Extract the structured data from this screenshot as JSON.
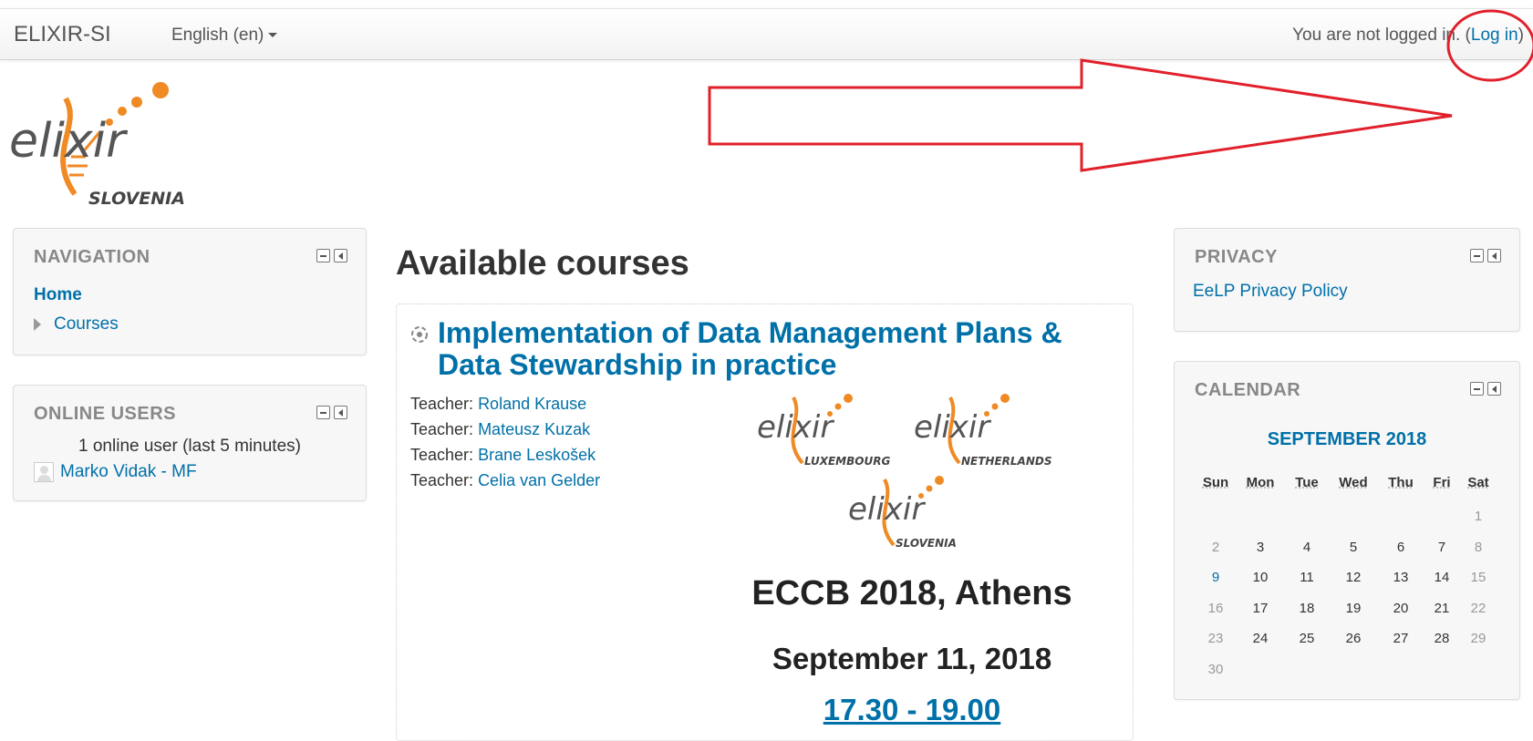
{
  "navbar": {
    "brand": "ELIXIR-SI",
    "language": "English (en)",
    "login_prefix": "You are not logged in.",
    "login_link": "Log in"
  },
  "logo": {
    "text": "elixir",
    "sub": "SLOVENIA"
  },
  "navigation": {
    "title": "NAVIGATION",
    "home": "Home",
    "courses": "Courses"
  },
  "online_users": {
    "title": "ONLINE USERS",
    "count": "1 online user (last 5 minutes)",
    "users": [
      "Marko Vidak - MF"
    ]
  },
  "main": {
    "heading": "Available courses",
    "course": {
      "title": "Implementation of Data Management Plans & Data Stewardship in practice",
      "teacher_label": "Teacher:",
      "teachers": [
        "Roland Krause",
        "Mateusz Kuzak",
        "Brane Leskošek",
        "Celia van Gelder"
      ],
      "logos": [
        {
          "text": "elixir",
          "sub": "LUXEMBOURG"
        },
        {
          "text": "elixir",
          "sub": "NETHERLANDS"
        },
        {
          "text": "elixir",
          "sub": "SLOVENIA"
        }
      ],
      "event": "ECCB 2018, Athens",
      "date": "September 11, 2018",
      "time": "17.30 - 19.00"
    }
  },
  "privacy": {
    "title": "PRIVACY",
    "link": "EeLP Privacy Policy"
  },
  "calendar": {
    "title": "CALENDAR",
    "month": "SEPTEMBER 2018",
    "days": [
      "Sun",
      "Mon",
      "Tue",
      "Wed",
      "Thu",
      "Fri",
      "Sat"
    ],
    "weeks": [
      [
        "",
        "",
        "",
        "",
        "",
        "",
        "1"
      ],
      [
        "2",
        "3",
        "4",
        "5",
        "6",
        "7",
        "8"
      ],
      [
        "9",
        "10",
        "11",
        "12",
        "13",
        "14",
        "15"
      ],
      [
        "16",
        "17",
        "18",
        "19",
        "20",
        "21",
        "22"
      ],
      [
        "23",
        "24",
        "25",
        "26",
        "27",
        "28",
        "29"
      ],
      [
        "30",
        "",
        "",
        "",
        "",
        "",
        ""
      ]
    ],
    "today": "9"
  },
  "colors": {
    "link": "#0070a8",
    "annotation": "#e0202a",
    "logo_orange": "#f08a24",
    "logo_gray": "#555555"
  },
  "icons": {
    "lang_caret": "chevron-down-icon",
    "minimize": "minimize-icon",
    "dock": "dock-icon",
    "expand": "triangle-right-icon",
    "course": "course-icon",
    "avatar": "user-avatar-icon"
  }
}
